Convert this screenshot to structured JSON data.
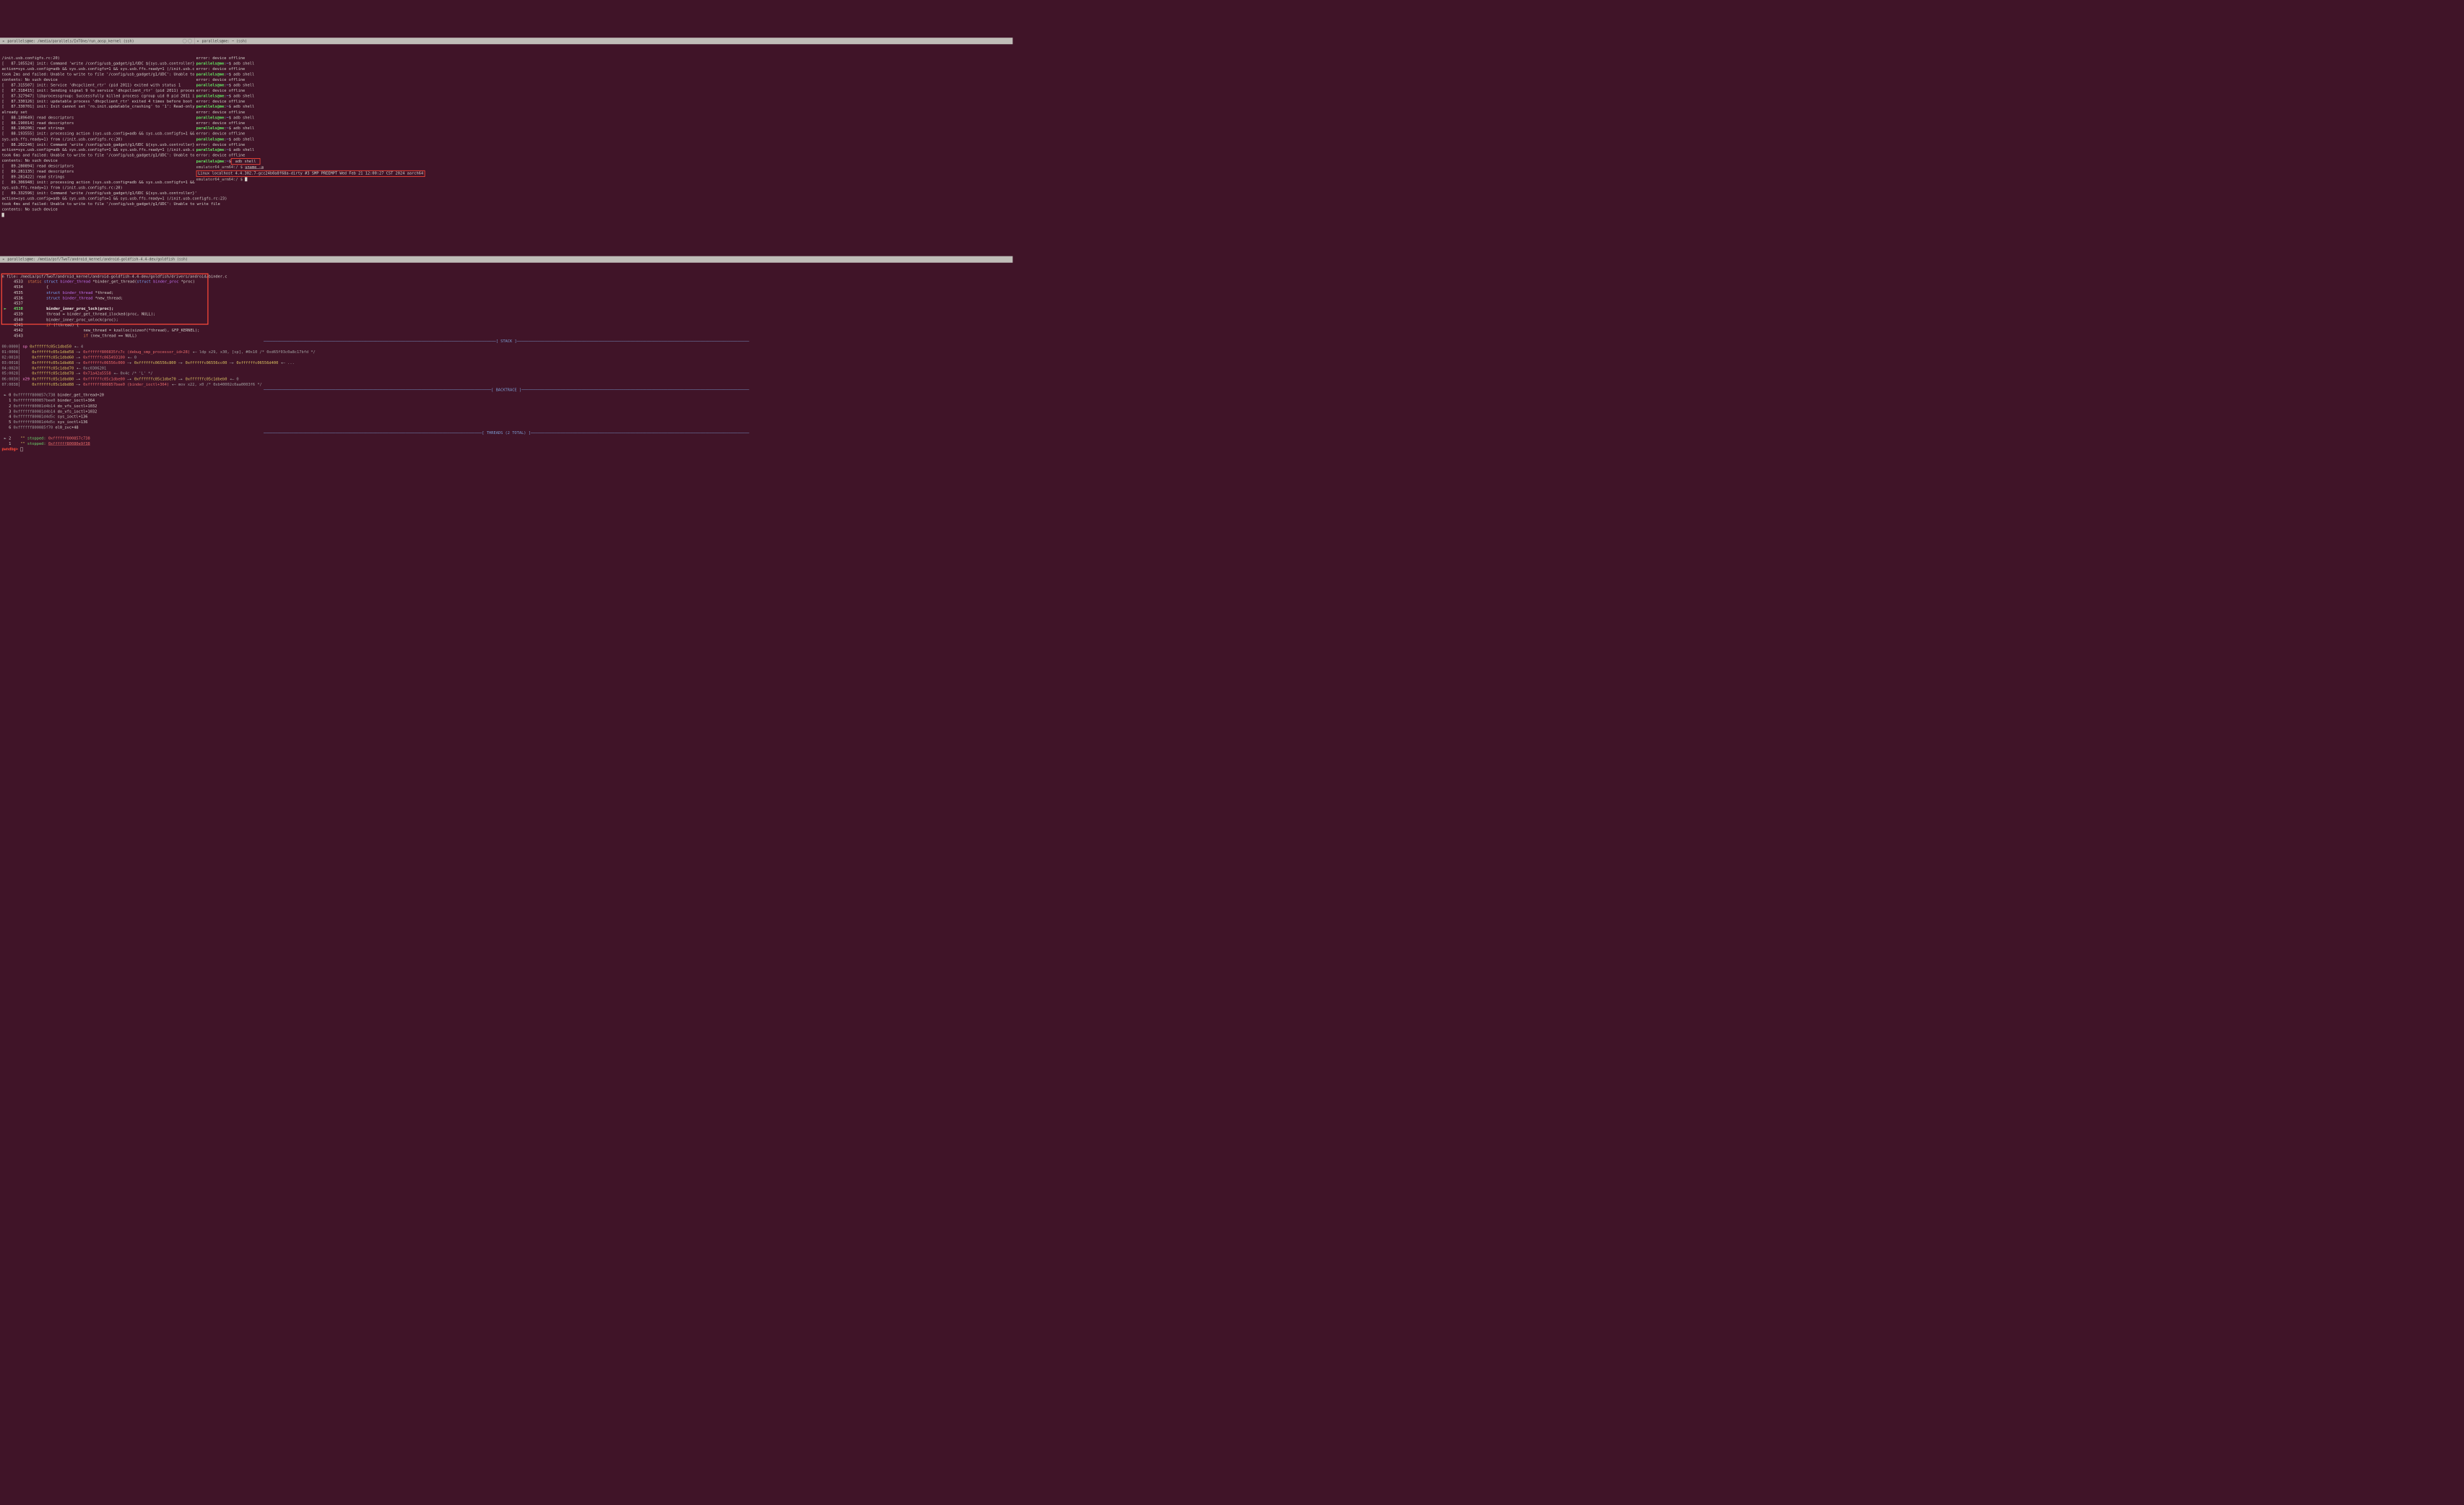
{
  "windows": {
    "top_left": {
      "title": "parallels@me: /media/parallels/InTOne/run_aosp_kernel (ssh)",
      "close_glyph": "✕",
      "log": [
        "/init.usb.configfs.rc:20)",
        "[   87.105524] init: Command 'write /config/usb_gadget/g1/UDC ${sys.usb.controller}' action=sys.usb.config=adb && sys.usb.configfs=1 && sys.usb.ffs.ready=1 (/init.usb.configfs.rc:23) took 2ms and failed: Unable to write to file '/config/usb_gadget/g1/UDC': Unable to write file contents: No such device",
        "[   87.315507] init: Service 'dhcpclient_rtr' (pid 2011) exited with status 1",
        "[   87.318415] init: Sending signal 9 to service 'dhcpclient_rtr' (pid 2011) process group...",
        "[   87.327947] libprocessgroup: Successfully killed process cgroup uid 0 pid 2011 in 1ms",
        "[   87.330126] init: updatable process 'dhcpclient_rtr' exited 4 times before boot completed",
        "[   87.330701] init: Init cannot set 'ro.init.updatable_crashing' to '1': Read-only property was already set",
        "[   88.189649] read descriptors",
        "[   88.190014] read descriptors",
        "[   88.190206] read strings",
        "[   88.193555] init: processing action (sys.usb.config=adb && sys.usb.configfs=1 && sys.usb.ffs.ready=1) from (/init.usb.configfs.rc:20)",
        "[   88.202246] init: Command 'write /config/usb_gadget/g1/UDC ${sys.usb.controller}' action=sys.usb.config=adb && sys.usb.configfs=1 && sys.usb.ffs.ready=1 (/init.usb.configfs.rc:23) took 6ms and failed: Unable to write to file '/config/usb_gadget/g1/UDC': Unable to write file contents: No such device",
        "[   89.280894] read descriptors",
        "[   89.281135] read descriptors",
        "[   89.281422] read strings",
        "[   89.306948] init: processing action (sys.usb.config=adb && sys.usb.configfs=1 && sys.usb.ffs.ready=1) from (/init.usb.configfs.rc:20)",
        "[   89.332596] init: Command 'write /config/usb_gadget/g1/UDC ${sys.usb.controller}' action=sys.usb.config=adb && sys.usb.configfs=1 && sys.usb.ffs.ready=1 (/init.usb.configfs.rc:23) took 4ms and failed: Unable to write to file '/config/usb_gadget/g1/UDC': Unable to write file contents: No such device"
      ]
    },
    "top_right": {
      "title": "parallels@me: ~ (ssh)",
      "close_glyph": "✕",
      "prompt_user": "parallels@me",
      "prompt_path": "~",
      "adb_cmd": "adb shell",
      "offline": "error: device offline",
      "emu_prompt": "emulator64_arm64:/ $",
      "uname_cmd": "uname -a",
      "uname_out": "Linux localhost 4.4.302.7-gcc24b0a8f68a-dirty #3 SMP PREEMPT Wed Feb 21 12:00:27 CST 2024 aarch64"
    },
    "bottom": {
      "title": "parallels@me: /media/psf/TwoT/android_kernel/android-goldfish-4.4-dev/goldfish (ssh)",
      "close_glyph": "✕",
      "file_header": "n file: /media/psf/TwoT/android_kernel/android-goldfish-4.4-dev/goldfish/drivers/android/binder.c",
      "code": [
        {
          "n": "4533",
          "txt_pre": "static",
          "txt_ty": "struct",
          "txt_st": "binder_thread",
          "txt_rest": " *binder_get_thread(struct binder_proc *proc)"
        },
        {
          "n": "4534",
          "raw": "{"
        },
        {
          "n": "4535",
          "txt_ty": "struct",
          "txt_st": "binder_thread",
          "txt_rest": " *thread;"
        },
        {
          "n": "4536",
          "txt_ty": "struct",
          "txt_st": "binder_thread",
          "txt_rest": " *new_thread;"
        },
        {
          "n": "4537",
          "raw": ""
        },
        {
          "n": "4538",
          "cur": true,
          "bold": "binder_inner_proc_lock(proc);"
        },
        {
          "n": "4539",
          "raw": "thread = binder_get_thread_ilocked(proc, NULL);"
        },
        {
          "n": "4540",
          "raw": "binder_inner_proc_unlock(proc);"
        },
        {
          "n": "4541",
          "kw": "if",
          "raw": " (!thread) {"
        },
        {
          "n": "4542",
          "raw": "new_thread = kzalloc(sizeof(*thread), GFP_KERNEL);",
          "indent": "                "
        },
        {
          "n": "4543",
          "kw": "if",
          "raw": " (new_thread == NULL)",
          "indent": "                "
        }
      ],
      "sections": {
        "stack": "────────────────────────────────────────────────────────────────────────────────────────────────────[ STACK ]────────────────────────────────────────────────────────────────────────────────────────────────────",
        "backtrace": "──────────────────────────────────────────────────────────────────────────────────────────────────[ BACKTRACE ]──────────────────────────────────────────────────────────────────────────────────────────────────",
        "threads": "──────────────────────────────────────────────────────────────────────────────────────────────[ THREADS (2 TOTAL) ]──────────────────────────────────────────────────────────────────────────────────────────────"
      },
      "stack": [
        {
          "off": "00:0000",
          "reg": "sp",
          "a": "0xffffffc05c1dbd50",
          "tail": " ◂— 4"
        },
        {
          "off": "01:0008",
          "a": "0xffffffc05c1dbd58",
          "arrow": "—▸",
          "b": "0xffffff800835fc7c",
          "sym": "(debug_smp_processor_id+28)",
          "tail": " ◂— ldp x29, x30, [sp], #0x10 /* 0xd65f03c0a8c17bfd */"
        },
        {
          "off": "02:0010",
          "a": "0xffffffc05c1dbd60",
          "arrow": "—▸",
          "b": "0xffffffc065493100",
          "tail": " ◂— 0"
        },
        {
          "off": "03:0018",
          "a": "0xffffffc05c1dbd68",
          "arrow": "—▸",
          "b": "0xffffffc06556c000",
          "arrow2": "—▸",
          "c": "0xffffffc06556c800",
          "arrow3": "—▸",
          "d": "0xffffffc06556cc00",
          "arrow4": "—▸",
          "e": "0xffffffc06556d400",
          "tail": " ◂— ..."
        },
        {
          "off": "04:0020",
          "a": "0xffffffc05c1dbd70",
          "tail": " ◂— 0xc0306201"
        },
        {
          "off": "05:0028",
          "a": "0xffffffc05c1dbd78",
          "arrow": "—▸",
          "b": "0x71a42a5558",
          "tail": " ◂— 0x4c /* 'L' */"
        },
        {
          "off": "06:0030",
          "reg": "x29",
          "a": "0xffffffc05c1dbd80",
          "arrow": "—▸",
          "b": "0xffffffc05c1dbe00",
          "arrow2": "—▸",
          "c": "0xffffffc05c1dbe70",
          "arrow3": "—▸",
          "d": "0xffffffc05c1dbeb0",
          "tail": " ◂— 0"
        },
        {
          "off": "07:0038",
          "a": "0xffffffc05c1dbd88",
          "arrow": "—▸",
          "b": "0xffffff800857bee0",
          "sym": "(binder_ioctl+364)",
          "tail": " ◂— mov x22, x0 /* 0xb40002c0aa0003f6 */"
        }
      ],
      "backtrace": [
        {
          "i": "0",
          "addr": "0xffffff800857c738",
          "sym": "binder_get_thread+20",
          "cur": true
        },
        {
          "i": "1",
          "addr": "0xffffff800857bee0",
          "sym": "binder_ioctl+364"
        },
        {
          "i": "2",
          "addr": "0xffffff80081d4b14",
          "sym": "do_vfs_ioctl+1032"
        },
        {
          "i": "3",
          "addr": "0xffffff80081d4b14",
          "sym": "do_vfs_ioctl+1032"
        },
        {
          "i": "4",
          "addr": "0xffffff80081d4d5c",
          "sym": "sys_ioctl+136"
        },
        {
          "i": "5",
          "addr": "0xffffff80081d4d5c",
          "sym": "sys_ioctl+136"
        },
        {
          "i": "6",
          "addr": "0xffffff800085f70",
          "sym": "el0_svc+48"
        }
      ],
      "threads": [
        {
          "i": "2",
          "state": "stopped:",
          "addr": "0xffffff800857c738",
          "sym": "<binder_get_thread+20>",
          "cur": true
        },
        {
          "i": "1",
          "state": "stopped:",
          "addr": "0xffffff80080e9f38",
          "sym": "<up_write+32>"
        }
      ],
      "prompt": "pwndbg>"
    }
  }
}
